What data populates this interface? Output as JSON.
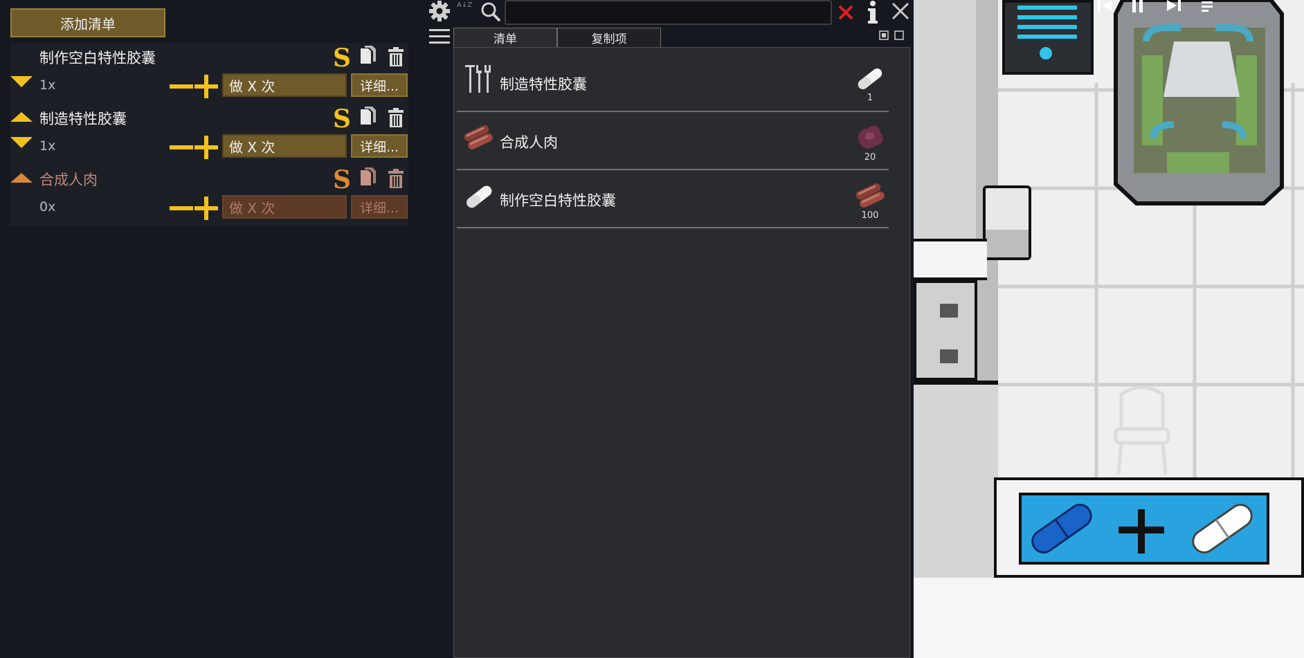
{
  "left_panel": {
    "add_bill_label": "添加清单",
    "bills": [
      {
        "name": "制作空白特性胶囊",
        "count": "1x",
        "repeat_label": "做 X 次",
        "details_label": "详细...",
        "enabled": true,
        "collapse": "down"
      },
      {
        "name": "制造特性胶囊",
        "count": "1x",
        "repeat_label": "做 X 次",
        "details_label": "详细...",
        "enabled": true,
        "collapse": "both"
      },
      {
        "name": "合成人肉",
        "count": "0x",
        "repeat_label": "做 X 次",
        "details_label": "详细...",
        "enabled": false,
        "collapse": "up"
      }
    ],
    "suspend_glyph": "S"
  },
  "toolbar": {
    "search_value": "",
    "sort_glyph": "A↓Z"
  },
  "tabs": [
    {
      "label": "清单",
      "active": true
    },
    {
      "label": "复制项",
      "active": false
    }
  ],
  "recipes": [
    {
      "name": "制造特性胶囊",
      "icon": "tools-icon",
      "product_icon": "capsule-icon",
      "qty": "1"
    },
    {
      "name": "合成人肉",
      "icon": "meat-icon",
      "product_icon": "flesh-icon",
      "qty": "20"
    },
    {
      "name": "制作空白特性胶囊",
      "icon": "capsule-icon",
      "product_icon": "meat-icon",
      "qty": "100"
    }
  ],
  "colors": {
    "accent": "#f4c21e",
    "disabled_text": "#c0867a",
    "close_red": "#e02020",
    "map_capsule_bg": "#29a3e0"
  }
}
